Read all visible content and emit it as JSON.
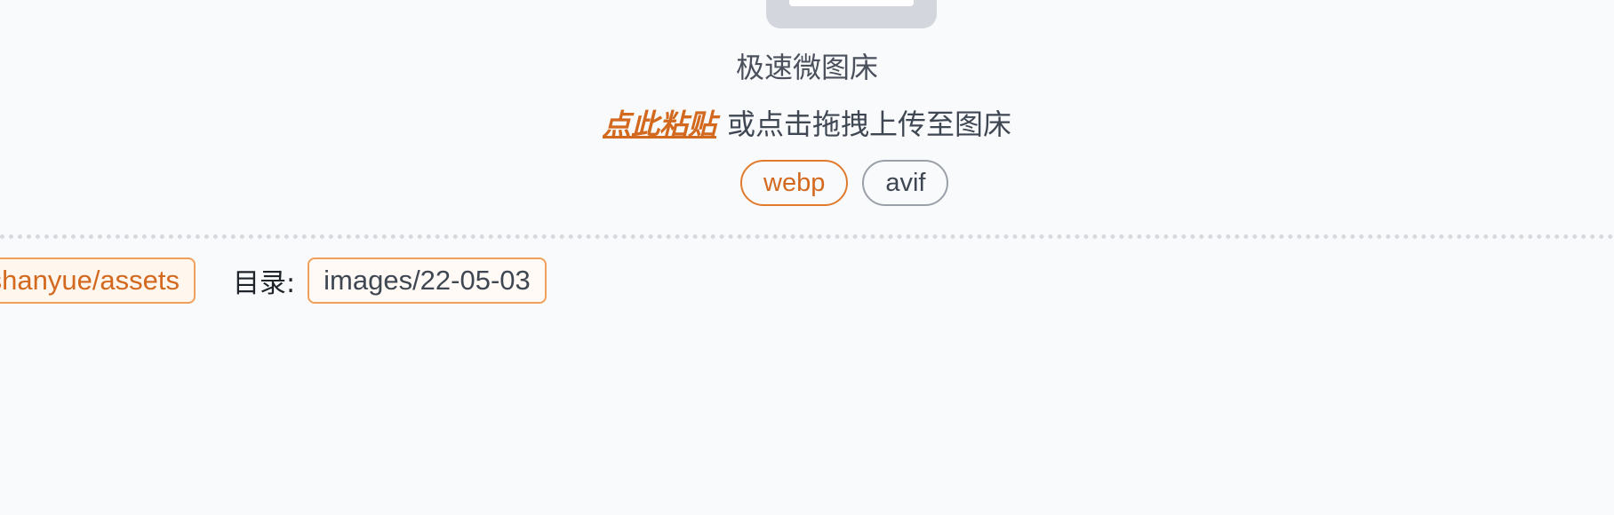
{
  "app": {
    "title": "极速微图床"
  },
  "upload": {
    "paste_link": "点此粘贴",
    "hint": "或点击拖拽上传至图床"
  },
  "formats": [
    {
      "label": "webp",
      "active": true
    },
    {
      "label": "avif",
      "active": false
    }
  ],
  "info": {
    "repo": "fshanyue/assets",
    "dir_label": "目录:",
    "dir_value": "images/22-05-03"
  },
  "colors": {
    "accent": "#d2691e",
    "background": "#f9fafc"
  }
}
